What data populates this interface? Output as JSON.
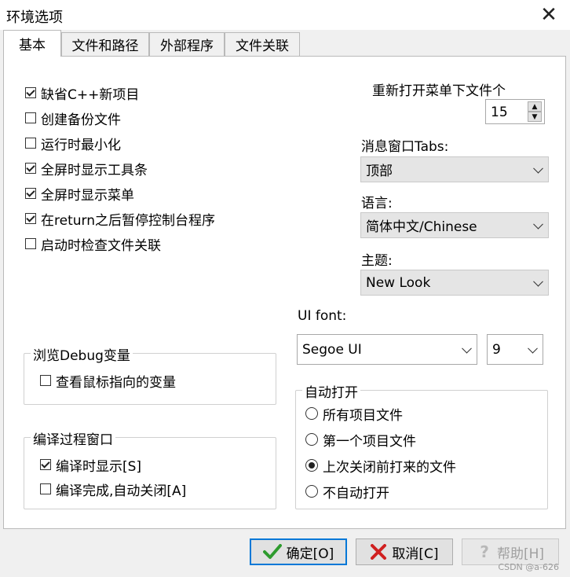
{
  "window": {
    "title": "环境选项"
  },
  "tabs": [
    {
      "label": "基本",
      "active": true
    },
    {
      "label": "文件和路径"
    },
    {
      "label": "外部程序"
    },
    {
      "label": "文件关联"
    }
  ],
  "options": [
    {
      "label": "缺省C++新项目",
      "checked": true
    },
    {
      "label": "创建备份文件",
      "checked": false
    },
    {
      "label": "运行时最小化",
      "checked": false
    },
    {
      "label": "全屏时显示工具条",
      "checked": true
    },
    {
      "label": "全屏时显示菜单",
      "checked": true
    },
    {
      "label": "在return之后暂停控制台程序",
      "checked": true
    },
    {
      "label": "启动时检查文件关联",
      "checked": false
    }
  ],
  "reopen": {
    "label": "重新打开菜单下文件个",
    "value": "15"
  },
  "message_tabs": {
    "label": "消息窗口Tabs:",
    "value": "顶部"
  },
  "language": {
    "label": "语言:",
    "value": "简体中文/Chinese"
  },
  "theme": {
    "label": "主题:",
    "value": "New Look"
  },
  "ui_font": {
    "label": "UI font:",
    "family": "Segoe UI",
    "size": "9"
  },
  "debug_group": {
    "title": "浏览Debug变量",
    "option": {
      "label": "查看鼠标指向的变量",
      "checked": false
    }
  },
  "compile_group": {
    "title": "编译过程窗口",
    "options": [
      {
        "label": "编译时显示[S]",
        "checked": true
      },
      {
        "label": "编译完成,自动关闭[A]",
        "checked": false
      }
    ]
  },
  "auto_open": {
    "title": "自动打开",
    "options": [
      {
        "label": "所有项目文件",
        "selected": false
      },
      {
        "label": "第一个项目文件",
        "selected": false
      },
      {
        "label": "上次关闭前打来的文件",
        "selected": true
      },
      {
        "label": "不自动打开",
        "selected": false
      }
    ]
  },
  "buttons": {
    "ok": "确定[O]",
    "cancel": "取消[C]",
    "help": "帮助[H]"
  },
  "watermark": "CSDN @a-626",
  "colors": {
    "accent": "#0078d7",
    "ok_icon": "#2e9b2e",
    "cancel_icon": "#d02020"
  }
}
